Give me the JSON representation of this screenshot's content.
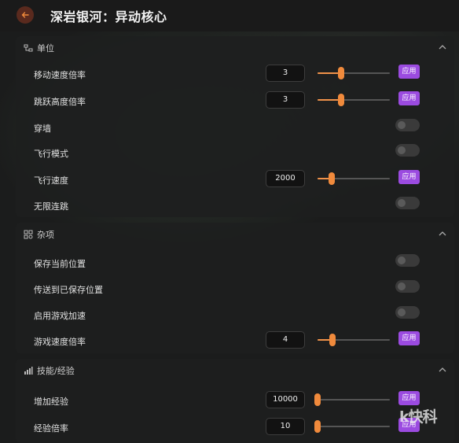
{
  "app": {
    "title": "深岩银河：异动核心"
  },
  "sections": [
    {
      "title": "单位",
      "rows": [
        {
          "label": "移动速度倍率",
          "type": "slider",
          "value": "3",
          "slider_fraction": 0.33,
          "apply": "应用"
        },
        {
          "label": "跳跃高度倍率",
          "type": "slider",
          "value": "3",
          "slider_fraction": 0.33,
          "apply": "应用"
        },
        {
          "label": "穿墙",
          "type": "toggle",
          "on": false
        },
        {
          "label": "飞行模式",
          "type": "toggle",
          "on": false
        },
        {
          "label": "飞行速度",
          "type": "slider",
          "value": "2000",
          "slider_fraction": 0.2,
          "apply": "应用"
        },
        {
          "label": "无限连跳",
          "type": "toggle",
          "on": false
        }
      ]
    },
    {
      "title": "杂项",
      "rows": [
        {
          "label": "保存当前位置",
          "type": "toggle",
          "on": false
        },
        {
          "label": "传送到已保存位置",
          "type": "toggle",
          "on": false
        },
        {
          "label": "启用游戏加速",
          "type": "toggle",
          "on": false
        },
        {
          "label": "游戏速度倍率",
          "type": "slider",
          "value": "4",
          "slider_fraction": 0.21,
          "apply": "应用"
        }
      ]
    },
    {
      "title": "技能/经验",
      "rows": [
        {
          "label": "增加经验",
          "type": "slider",
          "value": "10000",
          "slider_fraction": 0.0,
          "apply": "应用"
        },
        {
          "label": "经验倍率",
          "type": "slider",
          "value": "10",
          "slider_fraction": 0.0,
          "apply": "应用"
        }
      ]
    }
  ],
  "watermark": "k快科",
  "colors": {
    "accent_orange": "#f08a3c",
    "apply_purple": "#9b4be0",
    "back_button": "#5a2a1e"
  },
  "icons": [
    "back-arrow-icon",
    "units-section-icon",
    "misc-section-icon",
    "skills-section-icon",
    "chevron-up-icon"
  ]
}
